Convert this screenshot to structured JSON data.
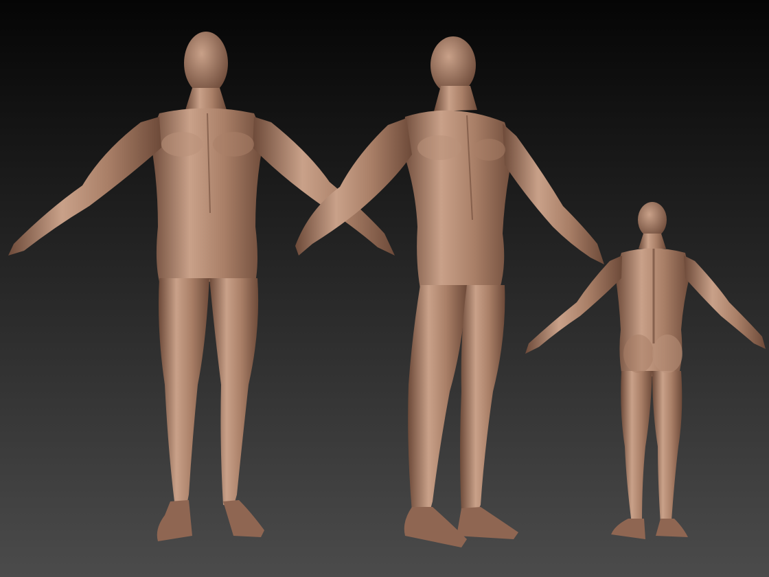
{
  "scene": {
    "background_top": "#050505",
    "background_bottom": "#4b4b4b",
    "clay_light": "#c9a189",
    "clay_mid": "#a97f67",
    "clay_dark": "#6d4a39",
    "clay_shadow": "#4a3126"
  },
  "figures": [
    {
      "id": "front-view",
      "view": "front"
    },
    {
      "id": "three-quarter-view",
      "view": "three-quarter"
    },
    {
      "id": "back-view",
      "view": "back"
    }
  ]
}
